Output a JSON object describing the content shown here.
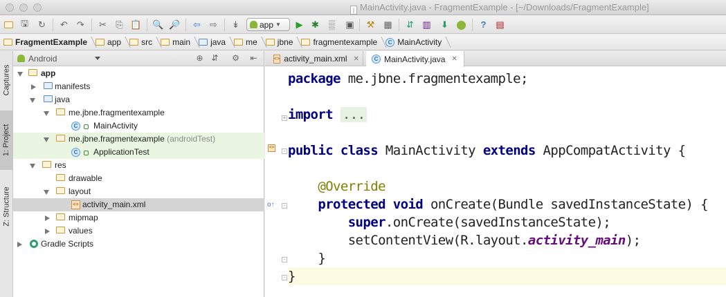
{
  "window": {
    "title": "MainActivity.java - FragmentExample - [~/Downloads/FragmentExample]"
  },
  "toolbar": {
    "run_config": "app"
  },
  "breadcrumbs": [
    "FragmentExample",
    "app",
    "src",
    "main",
    "java",
    "me",
    "jbne",
    "fragmentexample",
    "MainActivity"
  ],
  "side_tabs": {
    "captures": "Captures",
    "project": "1: Project",
    "structure": "Z: Structure"
  },
  "project_panel": {
    "view_mode": "Android",
    "tree": {
      "app": "app",
      "manifests": "manifests",
      "java": "java",
      "package_main": "me.jbne.fragmentexample",
      "main_activity": "MainActivity",
      "package_test": "me.jbne.fragmentexample",
      "package_test_suffix": "(androidTest)",
      "application_test": "ApplicationTest",
      "res": "res",
      "drawable": "drawable",
      "layout": "layout",
      "activity_main_xml": "activity_main.xml",
      "mipmap": "mipmap",
      "values": "values",
      "gradle_scripts": "Gradle Scripts"
    }
  },
  "editor": {
    "tabs": [
      {
        "label": "activity_main.xml",
        "active": false
      },
      {
        "label": "MainActivity.java",
        "active": true
      }
    ],
    "code": {
      "l1_kw": "package",
      "l1_rest": " me.jbne.fragmentexample;",
      "l2_kw": "import",
      "l2_fold": "...",
      "l3_kw1": "public",
      "l3_kw2": "class",
      "l3_name": " MainActivity ",
      "l3_kw3": "extends",
      "l3_rest": " AppCompatActivity {",
      "l4_ann": "@Override",
      "l5_kw1": "protected",
      "l5_kw2": "void",
      "l5_rest": " onCreate(Bundle savedInstanceState) {",
      "l6_kw": "super",
      "l6_rest": ".onCreate(savedInstanceState);",
      "l7_pre": "setContentView(R.layout.",
      "l7_field": "activity_main",
      "l7_post": ");",
      "l8": "}",
      "l9": "}"
    }
  }
}
